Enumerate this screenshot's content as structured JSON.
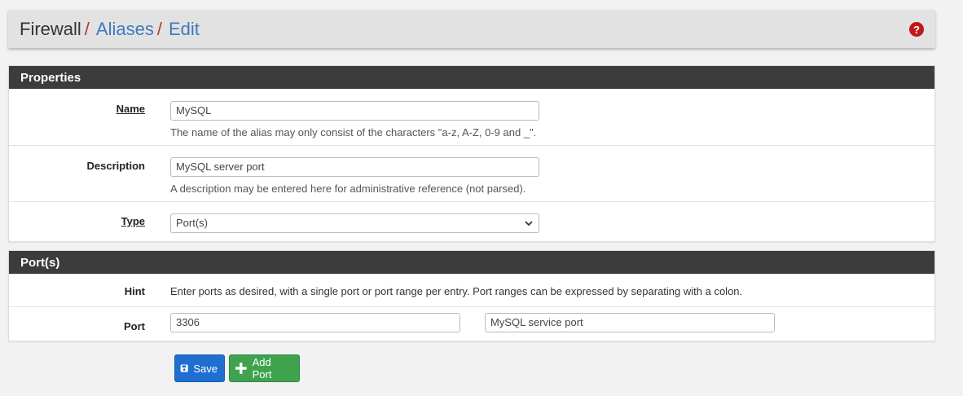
{
  "breadcrumb": {
    "items": [
      "Firewall",
      "Aliases",
      "Edit"
    ],
    "separator": "/"
  },
  "help_icon_glyph": "?",
  "properties": {
    "heading": "Properties",
    "name": {
      "label": "Name",
      "value": "MySQL",
      "help": "The name of the alias may only consist of the characters \"a-z, A-Z, 0-9 and _\"."
    },
    "description": {
      "label": "Description",
      "value": "MySQL server port",
      "help": "A description may be entered here for administrative reference (not parsed)."
    },
    "type": {
      "label": "Type",
      "selected": "Port(s)"
    }
  },
  "ports": {
    "heading": "Port(s)",
    "hint_label": "Hint",
    "hint_text": "Enter ports as desired, with a single port or port range per entry. Port ranges can be expressed by separating with a colon.",
    "port_label": "Port",
    "entries": [
      {
        "port": "3306",
        "description": "MySQL service port"
      }
    ]
  },
  "buttons": {
    "save": "Save",
    "add_port": "Add Port"
  },
  "colors": {
    "save": "#1f6fd0",
    "add": "#3fa34d",
    "heading": "#3c3c3c",
    "link": "#3e7bbf",
    "help_icon": "#c01818"
  }
}
